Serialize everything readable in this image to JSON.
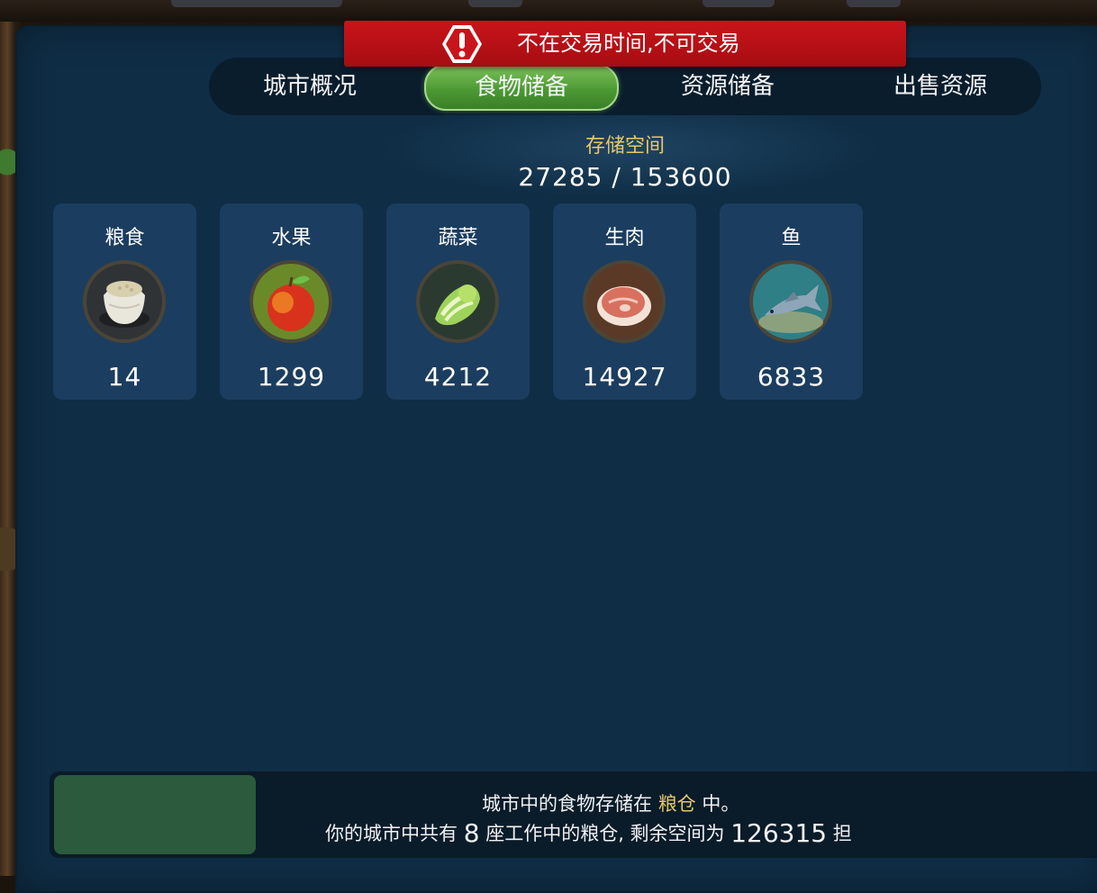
{
  "alert": {
    "text": "不在交易时间,不可交易",
    "icon": "exclamation-icon",
    "color": "#b5111a"
  },
  "tabs": [
    {
      "label": "城市概况",
      "active": false
    },
    {
      "label": "食物储备",
      "active": true
    },
    {
      "label": "资源储备",
      "active": false
    },
    {
      "label": "出售资源",
      "active": false
    }
  ],
  "storage": {
    "title": "存储空间",
    "used": 27285,
    "capacity": 153600,
    "display": "27285 / 153600"
  },
  "foods": [
    {
      "name": "粮食",
      "count": "14",
      "icon": "grain-sack-icon"
    },
    {
      "name": "水果",
      "count": "1299",
      "icon": "apple-icon"
    },
    {
      "name": "蔬菜",
      "count": "4212",
      "icon": "cabbage-icon"
    },
    {
      "name": "生肉",
      "count": "14927",
      "icon": "raw-meat-icon"
    },
    {
      "name": "鱼",
      "count": "6833",
      "icon": "fish-icon"
    }
  ],
  "footer": {
    "line1_prefix": "城市中的食物存储在 ",
    "line1_highlight": "粮仓",
    "line1_suffix": " 中。",
    "line2_prefix": "你的城市中共有 ",
    "line2_count": "8",
    "line2_middle": " 座工作中的粮仓, 剩余空间为 ",
    "line2_remaining": "126315",
    "line2_suffix": " 担"
  },
  "colors": {
    "panel": "#0f2d45",
    "card": "#1b3d5f",
    "active_tab": "#4d9a34",
    "highlight_text": "#e5c86a"
  }
}
